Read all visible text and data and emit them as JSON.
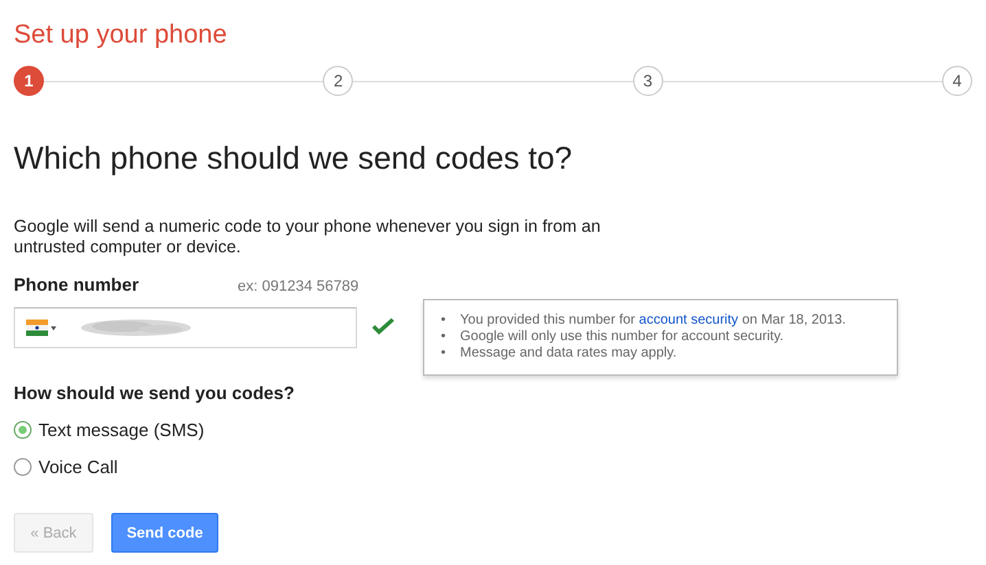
{
  "title": "Set up your phone",
  "steps": [
    {
      "label": "1",
      "selected": true
    },
    {
      "label": "2",
      "selected": false
    },
    {
      "label": "3",
      "selected": false
    },
    {
      "label": "4",
      "selected": false
    }
  ],
  "heading": "Which phone should we send codes to?",
  "intro": "Google will send a numeric code to your phone whenever you sign in from an untrusted computer or device.",
  "phone": {
    "label": "Phone number",
    "example": "ex: 091234 56789",
    "valid": true
  },
  "tooltip": {
    "items": [
      {
        "bullet": "•",
        "text": "You provided this number for",
        "link": "account security",
        "after": "on Mar 18, 2013."
      },
      {
        "bullet": "•",
        "text": "Google will only use this number for account security."
      },
      {
        "bullet": "•",
        "text": "Message and data rates may apply."
      }
    ]
  },
  "method": {
    "question": "How should we send you codes?",
    "options": [
      {
        "label": "Text message (SMS)",
        "selected": true
      },
      {
        "label": "Voice Call",
        "selected": false
      }
    ]
  },
  "buttons": [
    {
      "label": "« Back",
      "disabled": true
    },
    {
      "label": "Send code",
      "disabled": false
    }
  ]
}
